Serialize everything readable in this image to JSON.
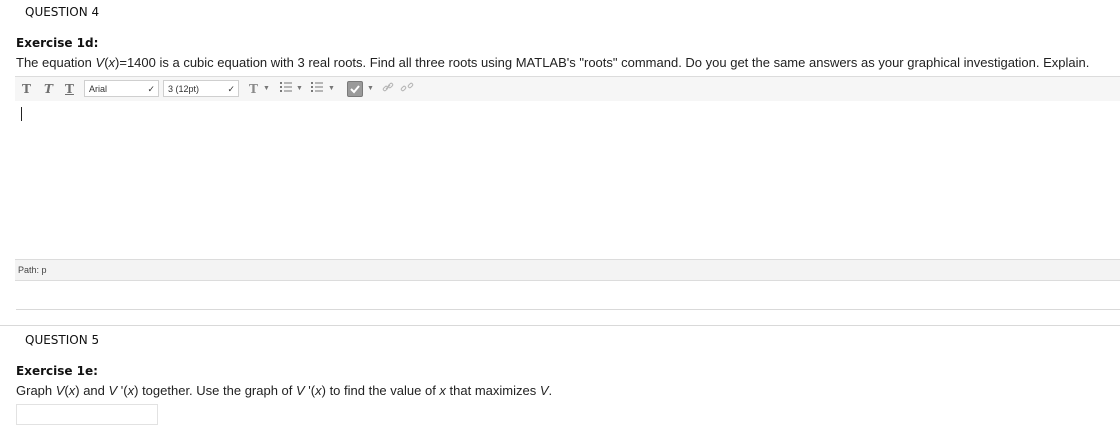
{
  "question4": {
    "header": "QUESTION 4",
    "exercise_title": "Exercise 1d:",
    "text_prefix": "The equation ",
    "text_func": "V",
    "text_paren_open": "(",
    "text_var": "x",
    "text_rest": ")=1400 is a cubic equation with 3 real roots. Find all three roots using MATLAB's \"roots\" command. Do you get the same answers as your graphical investigation. Explain."
  },
  "editor": {
    "toolbar": {
      "bold_label": "T",
      "italic_label": "T",
      "underline_label": "T",
      "font_family_value": "Arial",
      "font_size_value": "3 (12pt)",
      "text_color_label": "T"
    },
    "path_label": "Path: p"
  },
  "question5": {
    "header": "QUESTION 5",
    "exercise_title": "Exercise 1e:",
    "t1": "Graph ",
    "t2": "V",
    "t3": "(",
    "t4": "x",
    "t5": ") and ",
    "t6": "V",
    "t7": " '(",
    "t8": "x",
    "t9": ") together. Use the graph of ",
    "t10": "V",
    "t11": " '(",
    "t12": "x",
    "t13": ") to find the value of ",
    "t14": "x",
    "t15": " that maximizes ",
    "t16": "V",
    "t17": "."
  },
  "icons": {
    "chevron": "chevron-down-icon",
    "bullet_list": "bullet-list-icon",
    "numbered_list": "numbered-list-icon",
    "spellcheck": "spellcheck-icon",
    "link": "link-icon",
    "unlink": "unlink-icon"
  }
}
